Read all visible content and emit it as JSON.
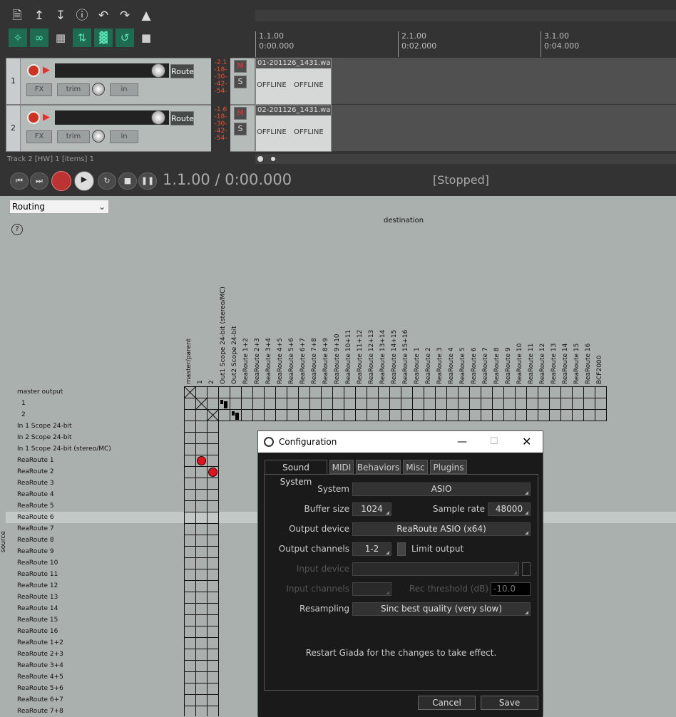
{
  "toolbar": {
    "icons": [
      "new-project-icon",
      "open-project-icon",
      "save-project-icon",
      "project-info-icon",
      "undo-icon",
      "redo-icon",
      "metronome-icon"
    ],
    "mode_icons": [
      "ripple-icon",
      "link-icon",
      "grid-icon",
      "snap-icon",
      "item-grid-icon",
      "loop-icon",
      "lock-icon"
    ]
  },
  "ruler": {
    "marks": [
      {
        "bar": "1.1.00",
        "time": "0:00.000"
      },
      {
        "bar": "2.1.00",
        "time": "0:02.000"
      },
      {
        "bar": "3.1.00",
        "time": "0:04.000"
      }
    ]
  },
  "tracks": [
    {
      "num": "1",
      "route": "Route",
      "fx": "FX",
      "trim": "trim",
      "in": "in",
      "meter": [
        "-2.1",
        "-18-",
        "-30-",
        "-42-",
        "-54-"
      ],
      "m": "M",
      "s": "S",
      "item": "01-201126_1431.wav",
      "offline1": "OFFLINE",
      "offline2": "OFFLINE"
    },
    {
      "num": "2",
      "route": "Route",
      "fx": "FX",
      "trim": "trim",
      "in": "in",
      "meter": [
        "-1.6",
        "-18-",
        "-30-",
        "-42-",
        "-54-"
      ],
      "m": "M",
      "s": "S",
      "item": "02-201126_1431.wav",
      "offline1": "OFFLINE",
      "offline2": "OFFLINE"
    }
  ],
  "status_line": "Track 2 [HW] 1 [items] 1",
  "transport": {
    "position": "1.1.00 / 0:00.000",
    "state": "[Stopped]"
  },
  "routing": {
    "view": "Routing",
    "help": "?",
    "destination_label": "destination",
    "source_label": "source",
    "columns": [
      "master/parent",
      "1",
      "2",
      "Out1 Scope 24-bit (stereo/MC)",
      "Out2 Scope 24-bit",
      "ReaRoute 1+2",
      "ReaRoute 2+3",
      "ReaRoute 3+4",
      "ReaRoute 4+5",
      "ReaRoute 5+6",
      "ReaRoute 6+7",
      "ReaRoute 7+8",
      "ReaRoute 8+9",
      "ReaRoute 9+10",
      "ReaRoute 10+11",
      "ReaRoute 11+12",
      "ReaRoute 12+13",
      "ReaRoute 13+14",
      "ReaRoute 14+15",
      "ReaRoute 15+16",
      "ReaRoute 1",
      "ReaRoute 2",
      "ReaRoute 3",
      "ReaRoute 4",
      "ReaRoute 5",
      "ReaRoute 6",
      "ReaRoute 7",
      "ReaRoute 8",
      "ReaRoute 9",
      "ReaRoute 10",
      "ReaRoute 11",
      "ReaRoute 12",
      "ReaRoute 13",
      "ReaRoute 14",
      "ReaRoute 15",
      "ReaRoute 16",
      "BCF2000"
    ],
    "rows": [
      "master output",
      "1",
      "2",
      "In 1 Scope 24-bit",
      "In 2 Scope 24-bit",
      "In 1 Scope 24-bit  (stereo/MC)",
      "ReaRoute 1",
      "ReaRoute 2",
      "ReaRoute 3",
      "ReaRoute 4",
      "ReaRoute 5",
      "ReaRoute 6",
      "ReaRoute 7",
      "ReaRoute 8",
      "ReaRoute 9",
      "ReaRoute 10",
      "ReaRoute 11",
      "ReaRoute 12",
      "ReaRoute 13",
      "ReaRoute 14",
      "ReaRoute 15",
      "ReaRoute 16",
      "ReaRoute 1+2",
      "ReaRoute 2+3",
      "ReaRoute 3+4",
      "ReaRoute 4+5",
      "ReaRoute 5+6",
      "ReaRoute 6+7",
      "ReaRoute 7+8"
    ],
    "highlighted_row": "ReaRoute 6",
    "active_color": "#e0141e"
  },
  "dialog": {
    "title": "Configuration",
    "tabs": [
      "Sound System",
      "MIDI",
      "Behaviors",
      "Misc",
      "Plugins"
    ],
    "active_tab": "Sound System",
    "fields": {
      "system_label": "System",
      "system_value": "ASIO",
      "buffer_label": "Buffer size",
      "buffer_value": "1024",
      "rate_label": "Sample rate",
      "rate_value": "48000",
      "outdev_label": "Output device",
      "outdev_value": "ReaRoute ASIO (x64)",
      "outch_label": "Output channels",
      "outch_value": "1-2",
      "limit_label": "Limit output",
      "indev_label": "Input device",
      "indev_value": "",
      "inch_label": "Input channels",
      "inch_value": "",
      "thresh_label": "Rec threshold (dB)",
      "thresh_value": "-10.0",
      "resamp_label": "Resampling",
      "resamp_value": "Sinc best quality (very slow)"
    },
    "notice": "Restart Giada for the changes to take effect.",
    "cancel": "Cancel",
    "save": "Save"
  }
}
